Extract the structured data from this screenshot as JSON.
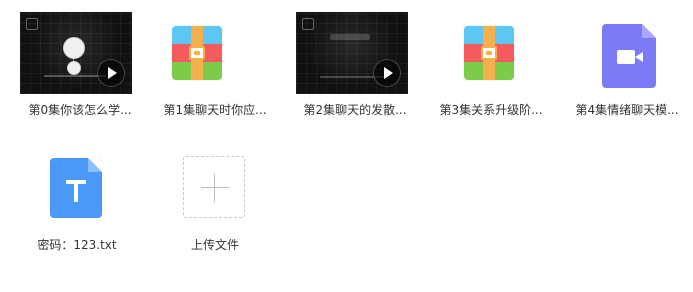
{
  "files": [
    {
      "name": "第0集你该怎么学...",
      "kind": "video-thumbnail",
      "icon": "video-thumbnail-icon"
    },
    {
      "name": "第1集聊天时你应...",
      "kind": "archive",
      "icon": "archive-icon"
    },
    {
      "name": "第2集聊天的发散...",
      "kind": "video-thumbnail",
      "icon": "video-thumbnail-icon"
    },
    {
      "name": "第3集关系升级阶...",
      "kind": "archive",
      "icon": "archive-icon"
    },
    {
      "name": "第4集情绪聊天模...",
      "kind": "video-file",
      "icon": "video-file-icon"
    },
    {
      "name": "密码：123.txt",
      "kind": "text-file",
      "icon": "text-file-icon"
    }
  ],
  "upload": {
    "label": "上传文件",
    "icon": "plus-icon"
  },
  "colors": {
    "label_text": "#333333",
    "archive_blue": "#5EC6F2",
    "archive_red": "#F25C5C",
    "archive_green": "#7CCB4A",
    "archive_strap": "#F4B04A",
    "video_file": "#7B7BF5",
    "text_file": "#4A98F7",
    "thumbnail_bg": "#111111"
  }
}
